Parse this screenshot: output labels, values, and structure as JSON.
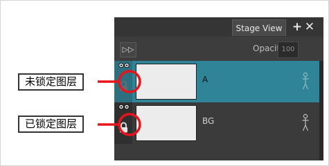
{
  "panel": {
    "tab_label": "Stage View",
    "add_symbol": "+",
    "close_symbol": "✕",
    "ff_symbol": "▷▷",
    "opacity_label": "Opacity",
    "opacity_value": "100"
  },
  "layers": [
    {
      "name": "A",
      "locked": false,
      "selected": true
    },
    {
      "name": "BG",
      "locked": true,
      "selected": false
    }
  ],
  "callouts": {
    "unlocked": "未锁定图层",
    "locked": "已锁定图层"
  },
  "colors": {
    "selected_row": "#2f8497",
    "callout_red": "#e8141c",
    "panel_bg": "#3b3b3b"
  }
}
